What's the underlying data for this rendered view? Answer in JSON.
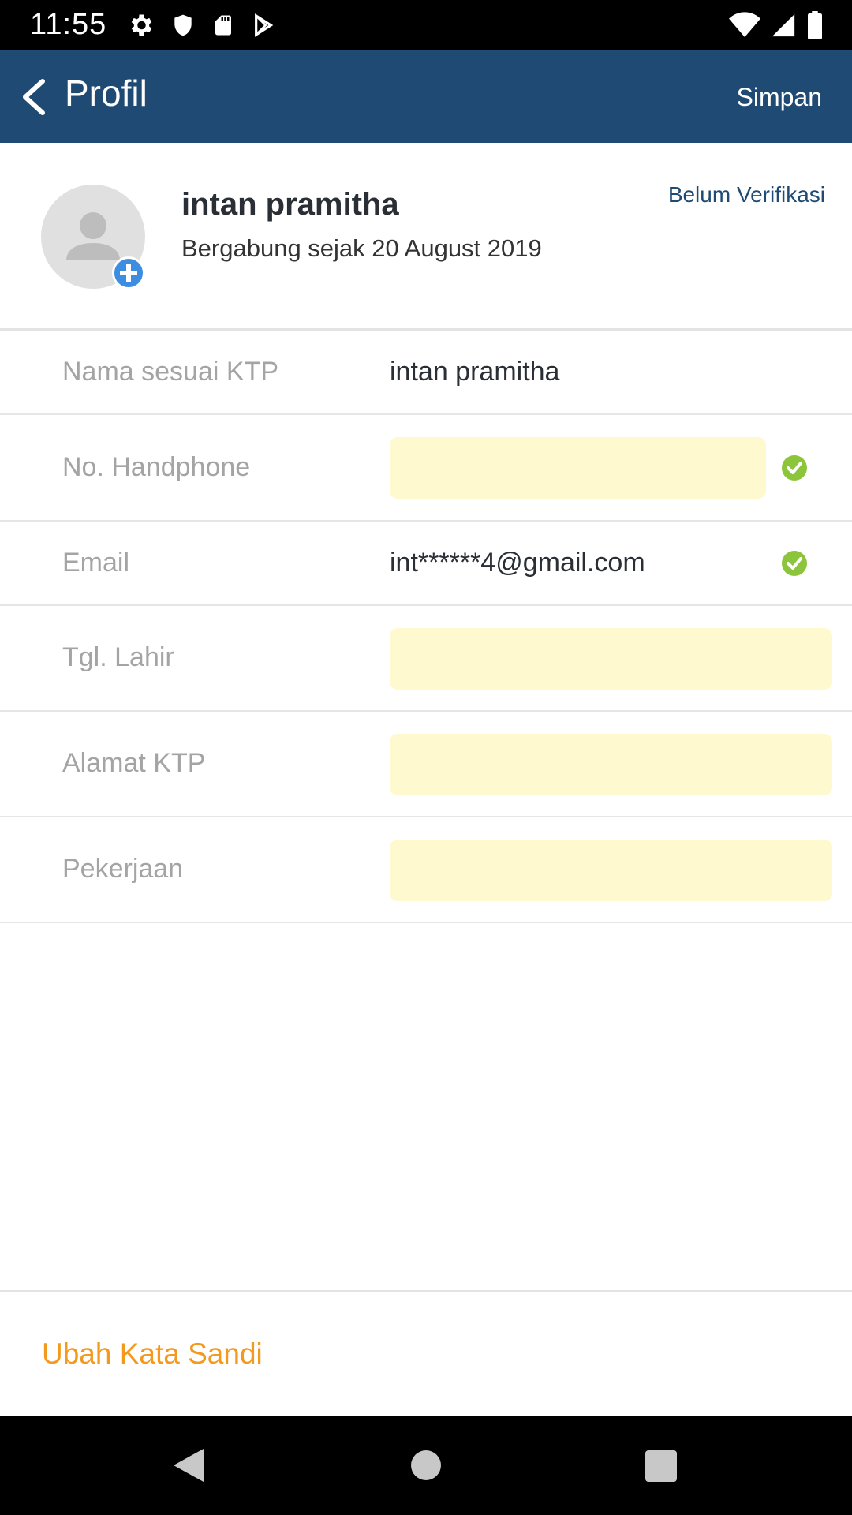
{
  "status_bar": {
    "time": "11:55",
    "icons_left": [
      "gear-icon",
      "shield-icon",
      "sd-card-icon",
      "play-store-icon"
    ],
    "icons_right": [
      "wifi-icon",
      "signal-icon",
      "battery-icon"
    ]
  },
  "app_bar": {
    "back_icon": "chevron-left-icon",
    "title": "Profil",
    "save_label": "Simpan",
    "background": "#1e4a74"
  },
  "profile": {
    "name": "intan pramitha",
    "joined": "Bergabung sejak 20 August 2019",
    "verification_status": "Belum Verifikasi",
    "avatar_icon": "person-icon",
    "add_photo_icon": "plus-circle-icon"
  },
  "fields": [
    {
      "label": "Nama sesuai KTP",
      "value": "intan pramitha",
      "type": "text",
      "verified": false
    },
    {
      "label": "No. Handphone",
      "value": "",
      "type": "input",
      "verified": true
    },
    {
      "label": "Email",
      "value": "int******4@gmail.com",
      "type": "text",
      "verified": true
    },
    {
      "label": "Tgl. Lahir",
      "value": "",
      "type": "input",
      "verified": false
    },
    {
      "label": "Alamat KTP",
      "value": "",
      "type": "input",
      "verified": false
    },
    {
      "label": "Pekerjaan",
      "value": "",
      "type": "input",
      "verified": false
    }
  ],
  "change_password_label": "Ubah Kata Sandi",
  "colors": {
    "accent_orange": "#f39a1e",
    "input_highlight": "#fff9cf",
    "check_green": "#8cc43c",
    "label_gray": "#a4a4a4"
  },
  "nav_bar": {
    "icons": [
      "back-triangle-icon",
      "home-circle-icon",
      "recent-square-icon"
    ]
  }
}
